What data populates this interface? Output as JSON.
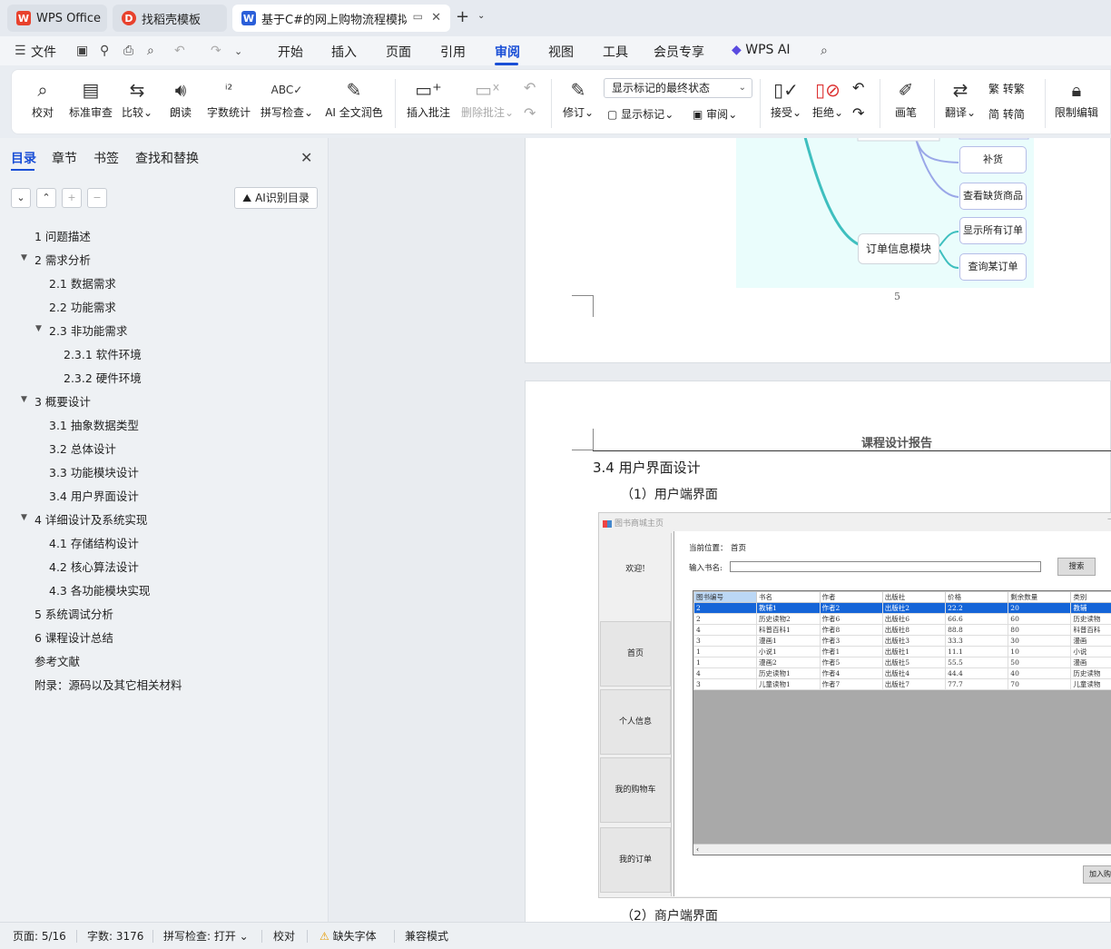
{
  "tabs": [
    {
      "label": "WPS Office",
      "logo": "W"
    },
    {
      "label": "找稻壳模板",
      "logo": "D"
    },
    {
      "label": "基于C#的网上购物流程模拟",
      "logo": "W"
    }
  ],
  "menu": {
    "file": "文件",
    "items": [
      "开始",
      "插入",
      "页面",
      "引用",
      "审阅",
      "视图",
      "工具",
      "会员专享"
    ],
    "active": "审阅",
    "ai": "WPS AI"
  },
  "ribbon": {
    "proofread": "校对",
    "standard_review": "标准审查",
    "compare": "比较",
    "read_aloud": "朗读",
    "word_count": "字数统计",
    "spell_check": "拼写检查",
    "ai_polish": "AI 全文润色",
    "insert_comment": "插入批注",
    "delete_comment": "删除批注",
    "revise": "修订",
    "markup_state": "显示标记的最终状态",
    "show_markup": "显示标记",
    "review": "审阅",
    "accept": "接受",
    "reject": "拒绝",
    "pen": "画笔",
    "translate": "翻译",
    "to_traditional": "转繁",
    "to_simplified": "转简",
    "restrict_edit": "限制编辑"
  },
  "sidebar": {
    "tabs": [
      "目录",
      "章节",
      "书签",
      "查找和替换"
    ],
    "ai_toc": "AI识别目录",
    "toc": [
      {
        "text": "1  问题描述",
        "level": 1,
        "expanded": null
      },
      {
        "text": "2  需求分析",
        "level": 1,
        "expanded": true
      },
      {
        "text": "2.1  数据需求",
        "level": 2,
        "expanded": null
      },
      {
        "text": "2.2  功能需求",
        "level": 2,
        "expanded": null
      },
      {
        "text": "2.3  非功能需求",
        "level": 2,
        "expanded": true
      },
      {
        "text": "2.3.1 软件环境",
        "level": 3,
        "expanded": null
      },
      {
        "text": "2.3.2 硬件环境",
        "level": 3,
        "expanded": null
      },
      {
        "text": "3  概要设计",
        "level": 1,
        "expanded": true
      },
      {
        "text": "3.1 抽象数据类型",
        "level": 2,
        "expanded": null
      },
      {
        "text": "3.2  总体设计",
        "level": 2,
        "expanded": null
      },
      {
        "text": "3.3  功能模块设计",
        "level": 2,
        "expanded": null
      },
      {
        "text": "3.4  用户界面设计",
        "level": 2,
        "expanded": null
      },
      {
        "text": "4  详细设计及系统实现",
        "level": 1,
        "expanded": true
      },
      {
        "text": "4.1  存储结构设计",
        "level": 2,
        "expanded": null
      },
      {
        "text": "4.2  核心算法设计",
        "level": 2,
        "expanded": null
      },
      {
        "text": "4.3  各功能模块实现",
        "level": 2,
        "expanded": null
      },
      {
        "text": "5  系统调试分析",
        "level": 1,
        "expanded": null
      },
      {
        "text": "6  课程设计总结",
        "level": 1,
        "expanded": null
      },
      {
        "text": "参考文献",
        "level": 1,
        "expanded": null
      },
      {
        "text": "附录：源码以及其它相关材料",
        "level": 1,
        "expanded": null
      }
    ]
  },
  "doc": {
    "mindmap": {
      "node_restock": "补货",
      "node_out_of_stock": "查看缺货商品",
      "main_node": "订单信息模块",
      "node_all_orders": "显示所有订单",
      "node_query_order": "查询某订单"
    },
    "page_number": "5",
    "report_header": "课程设计报告",
    "heading": "3.4  用户界面设计",
    "sub1": "（1）用户端界面",
    "sub2": "（2）商户端界面",
    "app": {
      "title": "图书商城主页",
      "welcome": "欢迎!",
      "nav": [
        "首页",
        "个人信息",
        "我的购物车",
        "我的订单"
      ],
      "location_label": "当前位置：",
      "location_value": "首页",
      "search_label": "输入书名:",
      "search_button": "搜索",
      "add_button": "加入购",
      "columns": [
        "图书编号",
        "书名",
        "作者",
        "出版社",
        "价格",
        "剩余数量",
        "类别"
      ],
      "rows": [
        [
          "2",
          "教辅1",
          "作者2",
          "出版社2",
          "22.2",
          "20",
          "教辅"
        ],
        [
          "2",
          "历史读物2",
          "作者6",
          "出版社6",
          "66.6",
          "60",
          "历史读物"
        ],
        [
          "4",
          "科普百科1",
          "作者8",
          "出版社8",
          "88.8",
          "80",
          "科普百科"
        ],
        [
          "3",
          "漫画1",
          "作者3",
          "出版社3",
          "33.3",
          "30",
          "漫画"
        ],
        [
          "1",
          "小说1",
          "作者1",
          "出版社1",
          "11.1",
          "10",
          "小说"
        ],
        [
          "1",
          "漫画2",
          "作者5",
          "出版社5",
          "55.5",
          "50",
          "漫画"
        ],
        [
          "4",
          "历史读物1",
          "作者4",
          "出版社4",
          "44.4",
          "40",
          "历史读物"
        ],
        [
          "3",
          "儿童读物1",
          "作者7",
          "出版社7",
          "77.7",
          "70",
          "儿童读物"
        ]
      ]
    }
  },
  "status": {
    "page": "页面: 5/16",
    "words": "字数: 3176",
    "spell": "拼写检查: 打开",
    "proof": "校对",
    "missing_font": "缺失字体",
    "compat": "兼容模式"
  },
  "colors": {
    "accent": "#1a4fd6",
    "wps_red": "#e8412c",
    "selection": "#1565d8"
  }
}
